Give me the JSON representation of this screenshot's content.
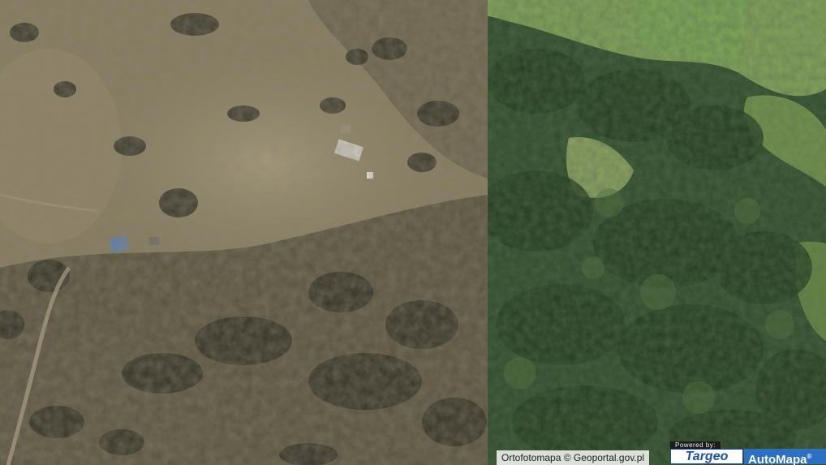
{
  "map": {
    "imagery_type": "aerial orthophoto",
    "tiles": [
      {
        "name": "left",
        "description_colors": {
          "base": "#8a7f63",
          "trees": "#3e3b2c"
        }
      },
      {
        "name": "right",
        "description_colors": {
          "base": "#2f4a2a",
          "meadow": "#7f9a55"
        }
      }
    ]
  },
  "attribution": {
    "text": "Ortofotomapa © Geoportal.gov.pl"
  },
  "branding": {
    "powered_by": "Powered by:",
    "targeo": "Targeo",
    "automapa": "AutoMapa",
    "automapa_mark": "®"
  }
}
